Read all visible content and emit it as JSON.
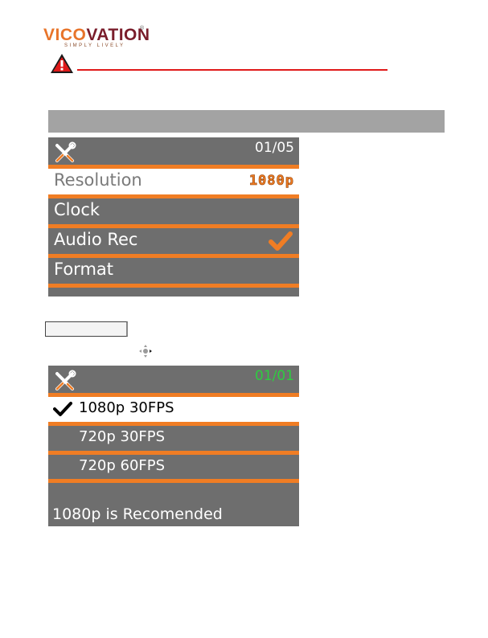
{
  "logo": {
    "part1": "VICO",
    "part2": "VATION",
    "reg": "®",
    "tagline": "SIMPLY LIVELY"
  },
  "icons": {
    "warning": "warning-icon",
    "settings": "tools-icon",
    "check": "check-icon",
    "dpad": "dpad-icon"
  },
  "colors": {
    "accent": "#f07d24",
    "screen_bg": "#6e6e6e",
    "warning_line": "#e01a1a",
    "page_num_green": "#2ecc40"
  },
  "screen1": {
    "page": "01/05",
    "items": [
      {
        "label": "Resolution",
        "value": "1080p",
        "selected": true
      },
      {
        "label": "Clock",
        "value": "",
        "selected": false
      },
      {
        "label": "Audio Rec",
        "value": "",
        "checked": true,
        "selected": false
      },
      {
        "label": "Format",
        "value": "",
        "selected": false
      }
    ]
  },
  "screen2": {
    "page": "01/01",
    "options": [
      {
        "label": "1080p 30FPS",
        "checked": true
      },
      {
        "label": "720p 30FPS",
        "checked": false
      },
      {
        "label": "720p 60FPS",
        "checked": false
      }
    ],
    "note": "1080p is Recomended"
  }
}
